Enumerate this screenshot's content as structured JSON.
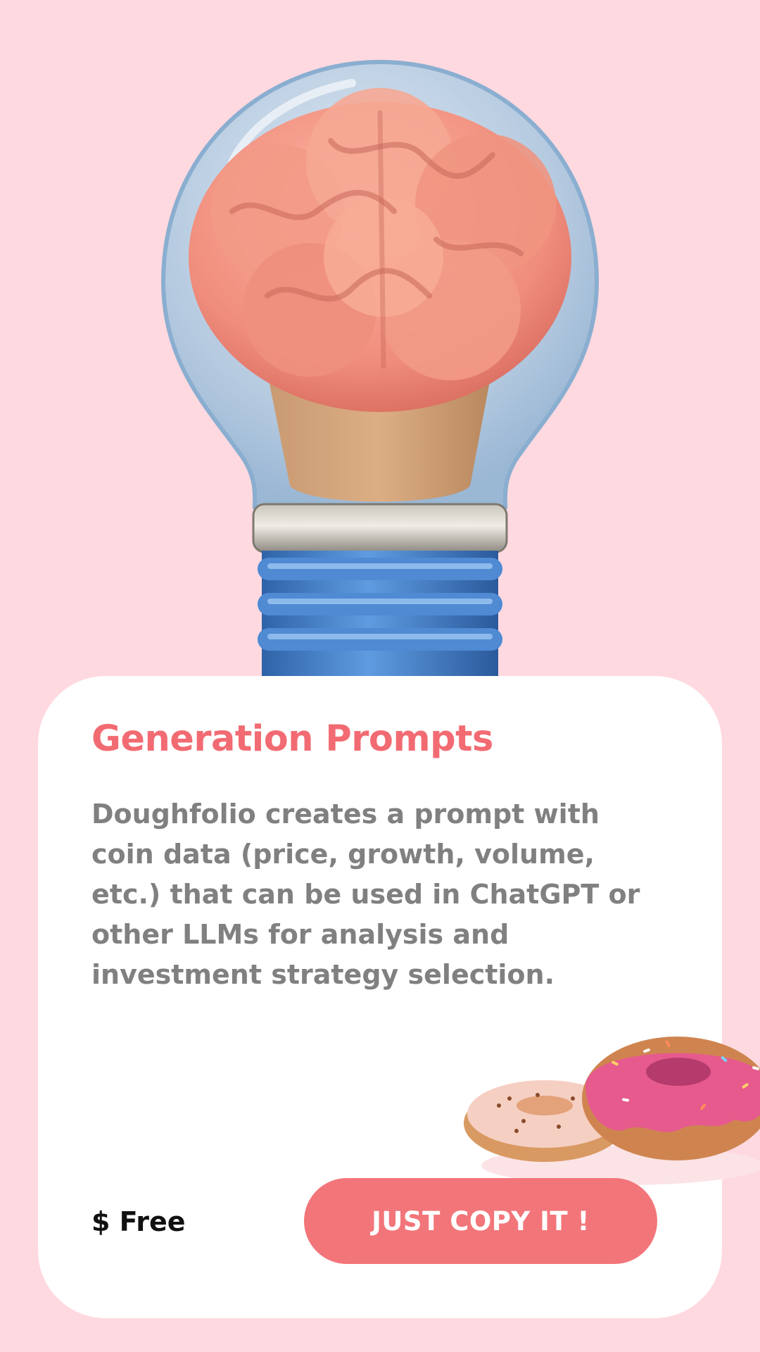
{
  "card": {
    "title": "Generation Prompts",
    "description": "Doughfolio creates a prompt with coin data (price, growth, volume, etc.) that can be used in ChatGPT or other LLMs for analysis and investment strategy selection.",
    "price_label": "$ Free",
    "button_label": "JUST COPY IT !"
  },
  "theme": {
    "background": "#ffd9e0",
    "card_background": "#ffffff",
    "accent": "#f26b72",
    "button_color": "#f2757a",
    "description_color": "#808080"
  },
  "images": {
    "hero": "lightbulb-with-brain-illustration",
    "decoration": "donuts-illustration"
  }
}
